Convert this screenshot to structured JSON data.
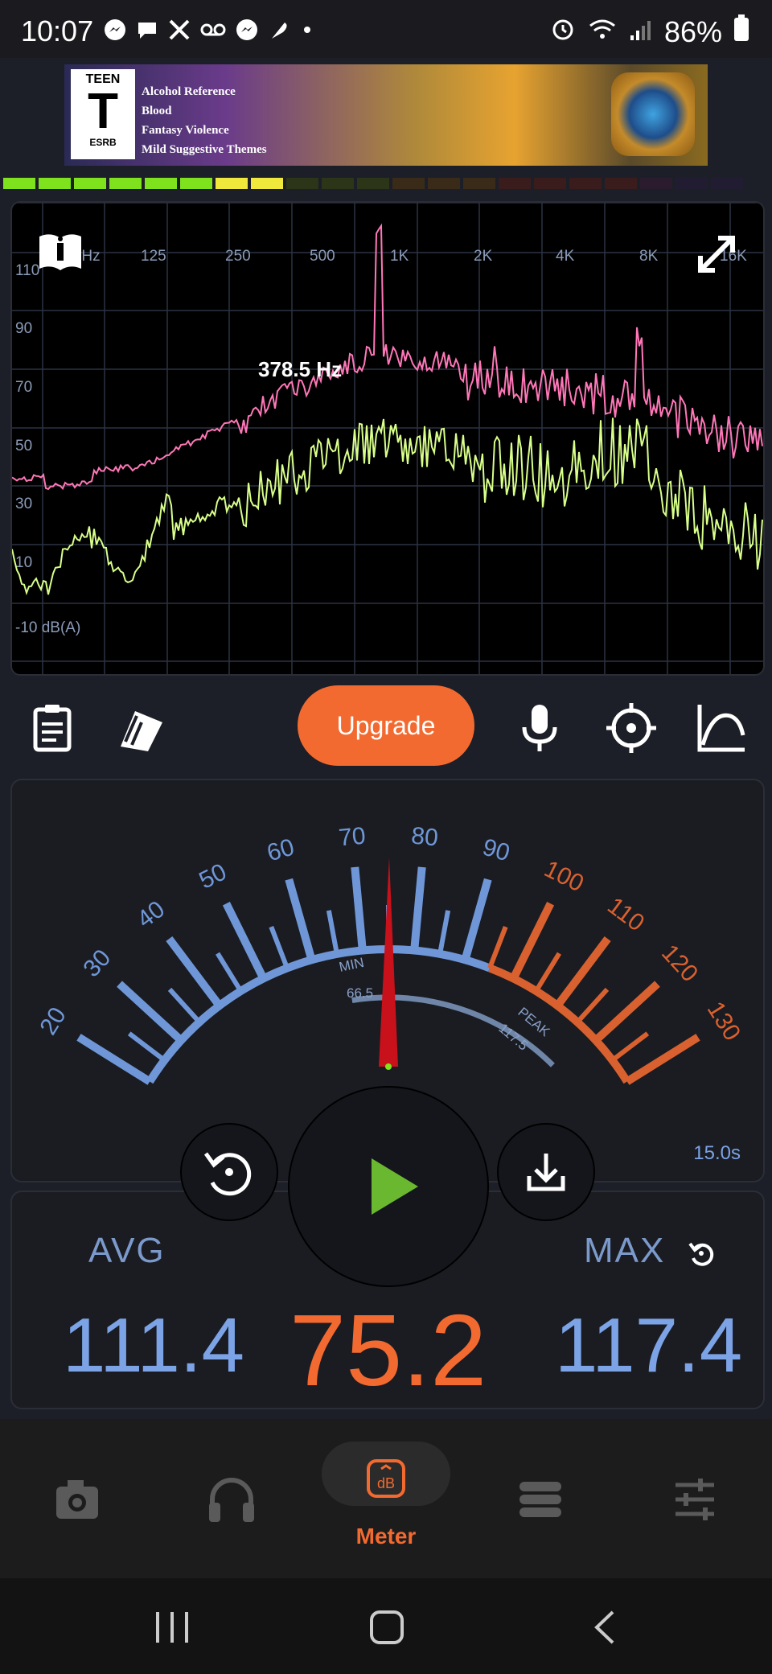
{
  "status_bar": {
    "time": "10:07",
    "battery": "86%"
  },
  "ad": {
    "rating_top": "TEEN",
    "rating_letter": "T",
    "rating_bottom": "ESRB",
    "descriptors": [
      "Alcohol Reference",
      "Blood",
      "Fantasy Violence",
      "Mild Suggestive Themes"
    ]
  },
  "spectrum": {
    "freq_labels": [
      "62 Hz",
      "125",
      "250",
      "500",
      "1K",
      "2K",
      "4K",
      "8K",
      "16K"
    ],
    "db_labels": [
      "110",
      "90",
      "70",
      "50",
      "30",
      "10",
      "-10 dB(A)"
    ],
    "peak_readout": "378.5 Hz",
    "colors": {
      "peak_line": "#ff77b8",
      "avg_line": "#d8ff8a",
      "grid": "#2b3242"
    }
  },
  "toolbar": {
    "upgrade_label": "Upgrade",
    "icons": [
      "clipboard-icon",
      "cards-icon",
      "microphone-icon",
      "crosshair-icon",
      "curve-icon"
    ]
  },
  "meter": {
    "scale_labels": [
      "20",
      "30",
      "40",
      "50",
      "60",
      "70",
      "80",
      "90",
      "100",
      "110",
      "120",
      "130"
    ],
    "min_label": "MIN",
    "min_value": "66.5",
    "peak_label": "PEAK",
    "peak_value": "117.5",
    "needle_value": 75.2,
    "timer": "15.0s",
    "colors": {
      "blue": "#6f97d8",
      "orange": "#d9612f",
      "needle": "#c8111a"
    }
  },
  "stats": {
    "avg_label": "AVG",
    "avg_value": "111.4",
    "current_value": "75.2",
    "max_label": "MAX",
    "max_value": "117.4"
  },
  "bottom_nav": {
    "active_label": "Meter",
    "items": [
      "camera-icon",
      "headphones-icon",
      "meter-icon",
      "list-icon",
      "sliders-icon"
    ]
  }
}
